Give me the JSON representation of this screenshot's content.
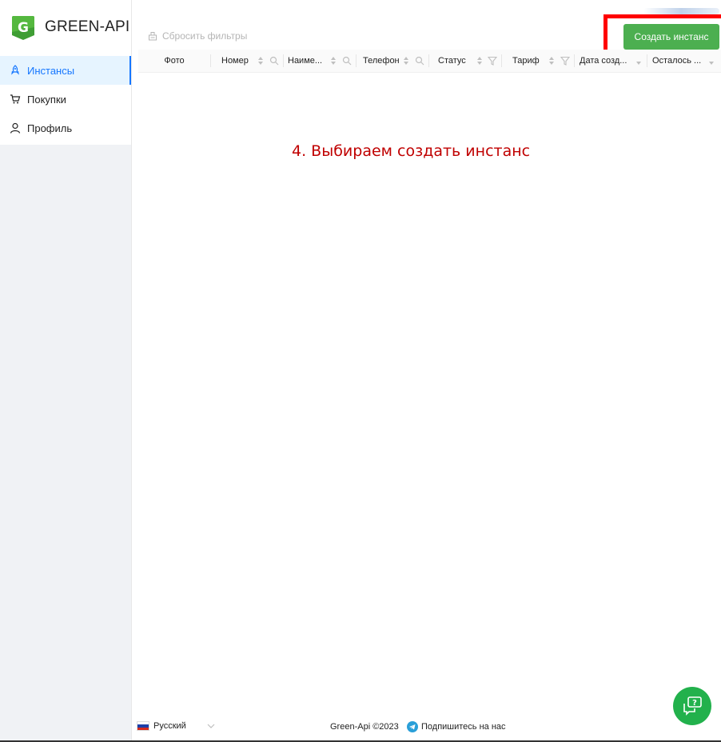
{
  "brand": {
    "name": "GREEN-API",
    "accent": "#4caf50",
    "logo_icon": "green-api-logo-icon"
  },
  "sidebar": {
    "items": [
      {
        "label": "Инстансы",
        "icon": "rocket-icon",
        "active": true
      },
      {
        "label": "Покупки",
        "icon": "cart-icon",
        "active": false
      },
      {
        "label": "Профиль",
        "icon": "user-icon",
        "active": false
      }
    ]
  },
  "toolbar": {
    "reset_filters_label": "Сбросить фильтры",
    "create_instance_label": "Создать инстанс"
  },
  "table": {
    "columns": [
      {
        "label": "Фото"
      },
      {
        "label": "Номер"
      },
      {
        "label": "Наиме..."
      },
      {
        "label": "Телефон"
      },
      {
        "label": "Статус"
      },
      {
        "label": "Тариф"
      },
      {
        "label": "Дата созд..."
      },
      {
        "label": "Осталось ..."
      }
    ]
  },
  "annotation": {
    "text": "4. Выбираем создать инстанс",
    "color": "#c00000",
    "highlight_color": "#ff0000"
  },
  "footer": {
    "language": "Русский",
    "copyright": "Green-Api ©2023",
    "subscribe": "Подпишитесь на нас"
  }
}
